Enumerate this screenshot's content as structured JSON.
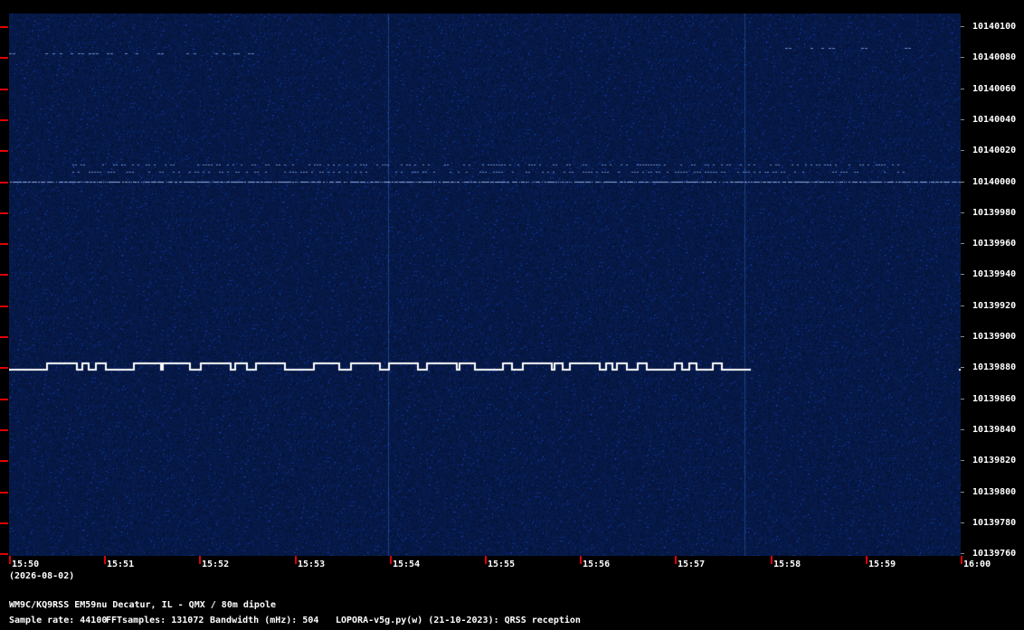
{
  "y_axis": {
    "labels": [
      "10140100",
      "10140080",
      "10140060",
      "10140040",
      "10140020",
      "10140000",
      "10139980",
      "10139960",
      "10139940",
      "10139920",
      "10139900",
      "10139880",
      "10139860",
      "10139840",
      "10139820",
      "10139800",
      "10139780",
      "10139760"
    ]
  },
  "x_axis": {
    "labels": [
      "15:50",
      "15:51",
      "15:52",
      "15:53",
      "15:54",
      "15:55",
      "15:56",
      "15:57",
      "15:58",
      "15:59",
      "16:00"
    ],
    "date": "(2026-08-02)"
  },
  "footer": {
    "station": "WM9C/KQ9RSS EM59nu Decatur, IL - QMX / 80m dipole",
    "sample_rate": "Sample rate: 44100",
    "fft_samples": "FFTsamples: 131072",
    "bandwidth": "Bandwidth (mHz): 504",
    "software": "LOPORA-v5g.py(w) (21-10-2023): QRSS reception"
  },
  "colors": {
    "background": "#000000",
    "waterfall_base": "#0d2458",
    "tick_red": "#e00000",
    "signal": "#ffffff"
  }
}
